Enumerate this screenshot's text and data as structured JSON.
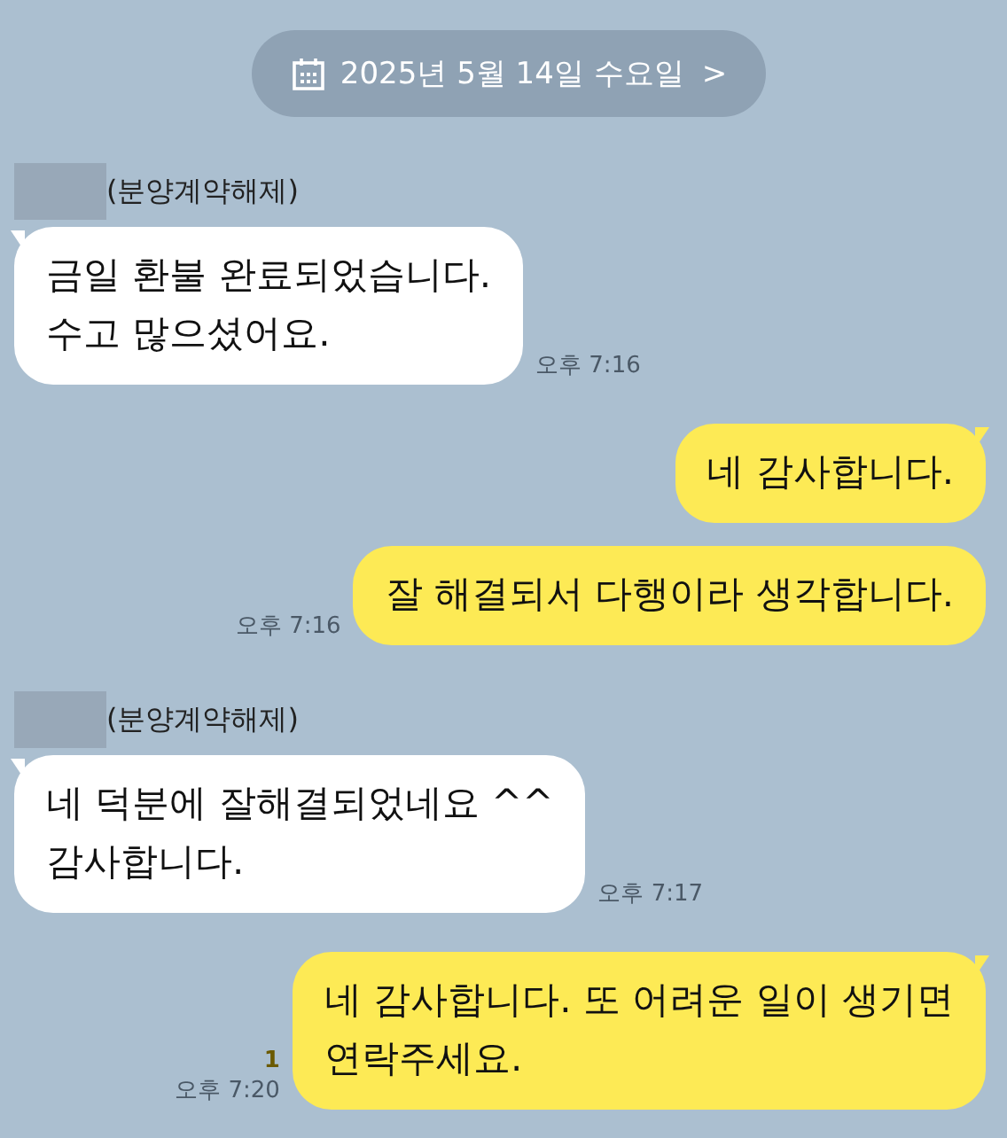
{
  "date_pill": {
    "label": "2025년 5월 14일 수요일",
    "chevron": ">"
  },
  "messages": [
    {
      "kind": "received",
      "sender": "(분양계약해제)",
      "text": "금일 환불 완료되었습니다.\n수고 많으셨어요.",
      "time": "오후 7:16"
    },
    {
      "kind": "sent",
      "text": "네 감사합니다."
    },
    {
      "kind": "sent",
      "text": "잘 해결되서 다행이라 생각합니다.",
      "time": "오후 7:16"
    },
    {
      "kind": "received",
      "sender": "(분양계약해제)",
      "text": "네 덕분에 잘해결되었네요 ^^\n감사합니다.",
      "time": "오후 7:17"
    },
    {
      "kind": "sent",
      "text": "네 감사합니다. 또 어려운 일이 생기면\n연락주세요.",
      "time": "오후 7:20",
      "unread": "1"
    }
  ]
}
